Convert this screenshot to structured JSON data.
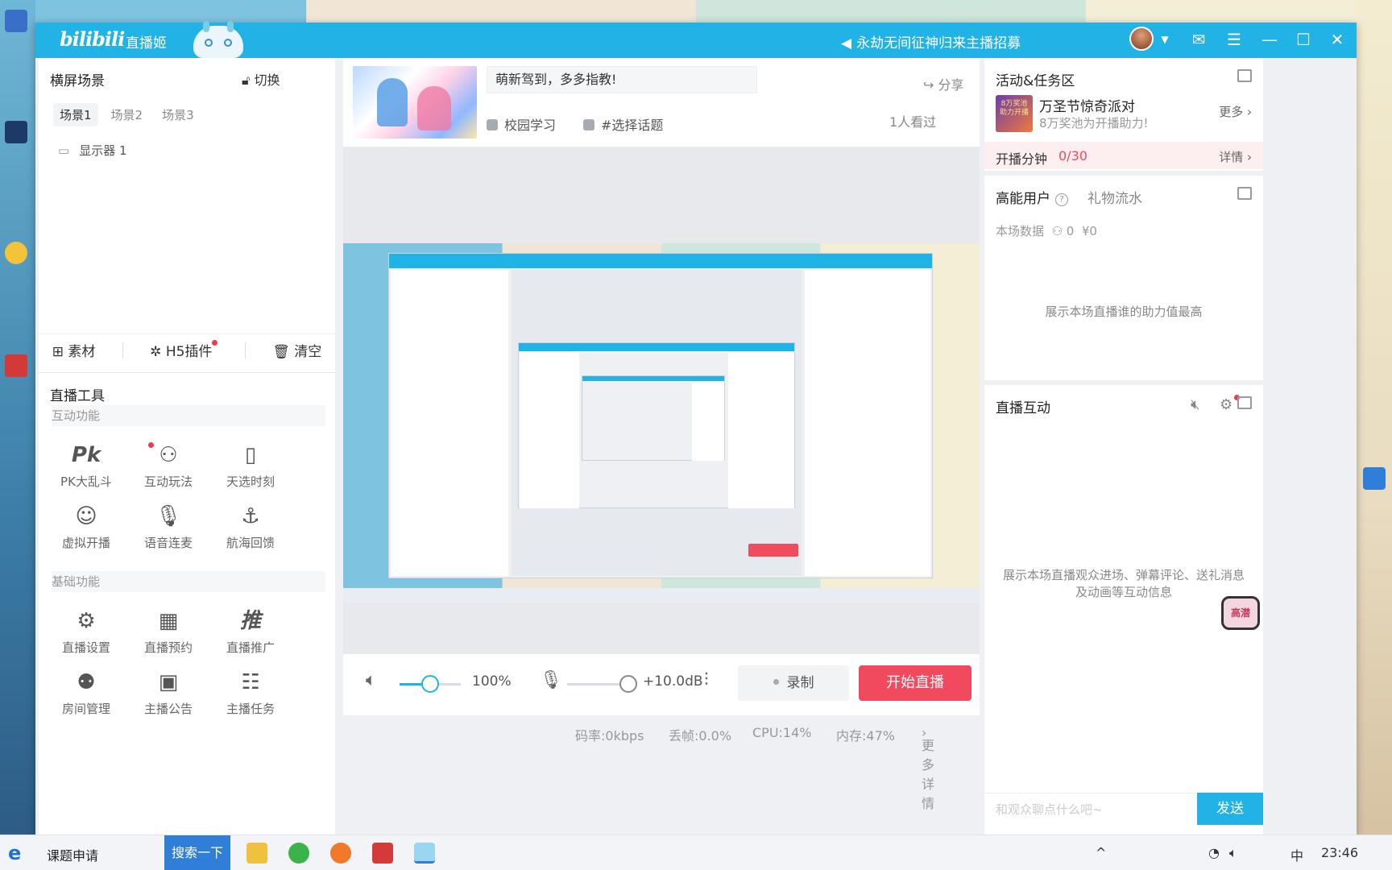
{
  "titlebar": {
    "logo": "bilibili",
    "app_name": "直播姬",
    "announcement": "永劫无间征神归来主播招募",
    "icons": [
      "megaphone-icon",
      "avatar",
      "mail-icon",
      "menu-icon",
      "minimize-icon",
      "maximize-icon",
      "close-icon"
    ]
  },
  "scene": {
    "title": "横屏场景",
    "switch_label": "切换",
    "tabs": [
      "场景1",
      "场景2",
      "场景3"
    ],
    "active_tab": "场景1",
    "sources": [
      "显示器 1"
    ],
    "actions": {
      "material": "素材",
      "h5_plugin": "H5插件",
      "clear": "清空"
    }
  },
  "tools": {
    "title": "直播工具",
    "interactive_label": "互动功能",
    "interactive": [
      "PK大乱斗",
      "互动玩法",
      "天选时刻",
      "虚拟开播",
      "语音连麦",
      "航海回馈"
    ],
    "basic_label": "基础功能",
    "basic": [
      "直播设置",
      "直播预约",
      "直播推广",
      "房间管理",
      "主播公告",
      "主播任务"
    ]
  },
  "room": {
    "title": "萌新驾到，多多指教!",
    "share": "分享",
    "category": "校园学习",
    "topic": "#选择话题",
    "viewers": "1人看过"
  },
  "controls": {
    "volume": "100%",
    "volume_level": 0.5,
    "mic_gain": "+10.0dB",
    "mic_level": 0.9,
    "record": "录制",
    "start_live": "开始直播"
  },
  "status": {
    "bitrate": "码率:0kbps",
    "dropped": "丢帧:0.0%",
    "cpu": "CPU:14%",
    "memory": "内存:47%",
    "more": "更多详情"
  },
  "activity": {
    "title": "活动&任务区",
    "thumb_text": "8万奖池 助力开播",
    "name": "万圣节惊奇派对",
    "sub": "8万奖池为开播助力!",
    "more": "更多",
    "minutes_label": "开播分钟",
    "minutes_value": "0/30",
    "detail": "详情"
  },
  "hot_users": {
    "title": "高能用户",
    "tab2": "礼物流水",
    "stats_label": "本场数据",
    "users": "0",
    "yuan": "¥0",
    "empty": "展示本场直播谁的助力值最高"
  },
  "interaction": {
    "title": "直播互动",
    "empty_line1": "展示本场直播观众进场、弹幕评论、送礼消息",
    "empty_line2": "及动画等互动信息",
    "badge": "高潜",
    "input_placeholder": "和观众聊点什么吧~",
    "send": "发送"
  },
  "taskbar": {
    "item": "课题申请",
    "search": "搜索一下",
    "time": "23:46",
    "ime": "中"
  }
}
